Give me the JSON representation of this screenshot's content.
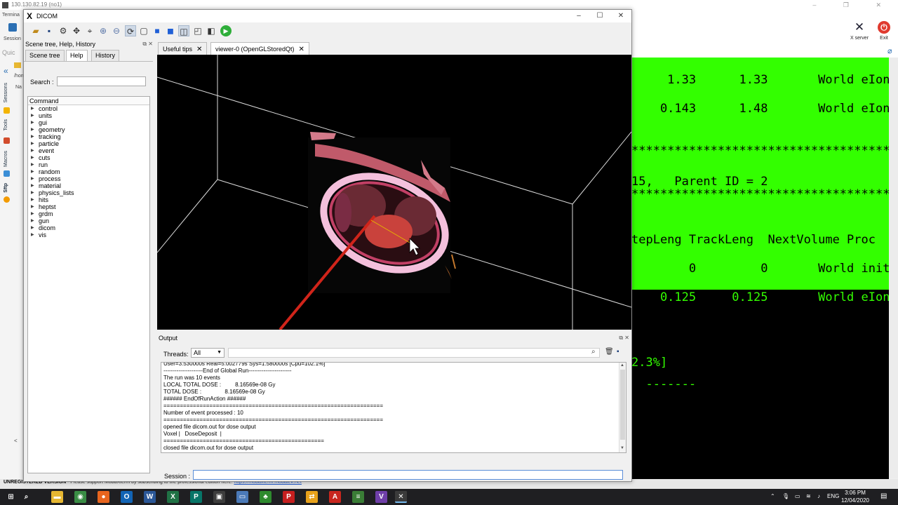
{
  "moba": {
    "title": "130.130.82.19 (no1)",
    "left_labels": [
      "Termina",
      "Session",
      "Quic",
      "/hon",
      "Na"
    ],
    "vtabs": [
      "Sessions",
      "Tools",
      "Macros",
      "Sftp"
    ],
    "tools": [
      {
        "label": "X server",
        "icon": "x-server-icon"
      },
      {
        "label": "Exit",
        "icon": "power-icon"
      }
    ],
    "status_bold": "UNREGISTERED VERSION",
    "status_text": " -  Please support MobaXterm by subscribing to the professional edition here:",
    "status_link": "https://mobaxterm.mobatek.net"
  },
  "terminal": {
    "lines": [
      {
        "text": "     1.33      1.33       World eIon",
        "bg": "green"
      },
      {
        "text": "    0.143      1.48       World eIon",
        "bg": "green"
      },
      {
        "text": "************************************",
        "bg": "green"
      },
      {
        "text": "15,   Parent ID = 2",
        "bg": "green"
      },
      {
        "text": "************************************",
        "bg": "green"
      },
      {
        "text": "tepLeng TrackLeng  NextVolume Proc",
        "bg": "green"
      },
      {
        "text": "        0         0       World init",
        "bg": "green"
      },
      {
        "text": "    0.125     0.125       World eIon",
        "bg": "black"
      },
      {
        "text": "2.3%]",
        "bg": "black"
      },
      {
        "text": "  -------",
        "bg": "black"
      }
    ]
  },
  "dicom": {
    "title": "DICOM",
    "dock_title": "Scene tree, Help, History",
    "tabs": [
      "Scene tree",
      "Help",
      "History"
    ],
    "selected_tab": "Help",
    "search_label": "Search :",
    "search_value": "",
    "tree_header": "Command",
    "commands": [
      "control",
      "units",
      "gui",
      "geometry",
      "tracking",
      "particle",
      "event",
      "cuts",
      "run",
      "random",
      "process",
      "material",
      "physics_lists",
      "hits",
      "heptst",
      "grdm",
      "gun",
      "dicom",
      "vis"
    ],
    "viewer_tabs": [
      "Useful tips",
      "viewer-0 (OpenGLStoredQt)"
    ],
    "output_title": "Output",
    "threads_label": "Threads:",
    "threads_value": "All",
    "output_lines": [
      "User=3.530000s Real=5.002779s Sys=1.580000s [Cpu=102.1%]",
      "---------------------End of Global Run-----------------------",
      "The run was 10 events",
      "LOCAL TOTAL DOSE :         8.16569e-08 Gy",
      "TOTAL DOSE :               8.16569e-08 Gy",
      "###### EndOfRunAction ######",
      "===================================================================",
      "Number of event processed : 10",
      "===================================================================",
      "opened file dicom.out for dose output",
      "Voxel |   DoseDeposit  |",
      "=================================================",
      "closed file dicom.out for dose output"
    ],
    "session_label": "Session :",
    "session_value": ""
  },
  "taskbar": {
    "apps": [
      "start",
      "search",
      "file-explorer",
      "chrome",
      "firefox",
      "outlook",
      "word",
      "excel",
      "publisher",
      "mobaxterm",
      "remote-desktop",
      "tree-app",
      "acrobat",
      "teamviewer",
      "pdf",
      "notepad",
      "visual-studio",
      "settings",
      "x-app"
    ],
    "lang": "ENG",
    "time": "3:06 PM",
    "date": "12/04/2020"
  }
}
